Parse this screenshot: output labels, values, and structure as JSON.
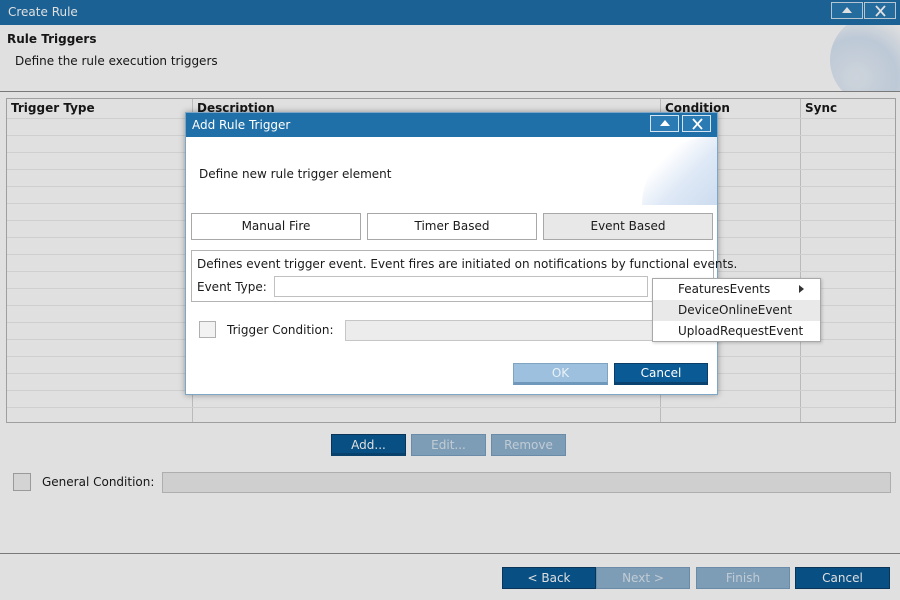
{
  "window": {
    "title": "Create Rule"
  },
  "page": {
    "section_title": "Rule Triggers",
    "section_subtitle": "Define the rule execution triggers"
  },
  "table": {
    "columns": [
      "Trigger Type",
      "Description",
      "Condition",
      "Sync"
    ]
  },
  "table_buttons": {
    "add": "Add...",
    "edit": "Edit...",
    "remove": "Remove"
  },
  "general_condition": {
    "label": "General Condition:",
    "checked": false,
    "value": ""
  },
  "wizard_buttons": {
    "back": "< Back",
    "next": "Next >",
    "finish": "Finish",
    "cancel": "Cancel"
  },
  "dialog": {
    "title": "Add Rule Trigger",
    "description": "Define new rule trigger element",
    "tabs": [
      {
        "label": "Manual Fire",
        "active": false
      },
      {
        "label": "Timer Based",
        "active": false
      },
      {
        "label": "Event Based",
        "active": true
      }
    ],
    "event_info": "Defines event trigger event. Event fires are initiated on notifications by functional events.",
    "event_type_label": "Event Type:",
    "event_type_value": "",
    "trigger_condition_label": "Trigger Condition:",
    "trigger_condition_checked": false,
    "ok_label": "OK",
    "cancel_label": "Cancel"
  },
  "event_menu": {
    "items": [
      {
        "label": "FeaturesEvents",
        "has_submenu": true
      },
      {
        "label": "DeviceOnlineEvent",
        "has_submenu": false,
        "highlighted": true
      },
      {
        "label": "UploadRequestEvent",
        "has_submenu": false
      }
    ]
  },
  "colors": {
    "titlebar": "#1f6fa8",
    "primary_button": "#0a5a96",
    "disabled_button": "#8fb3d1"
  }
}
